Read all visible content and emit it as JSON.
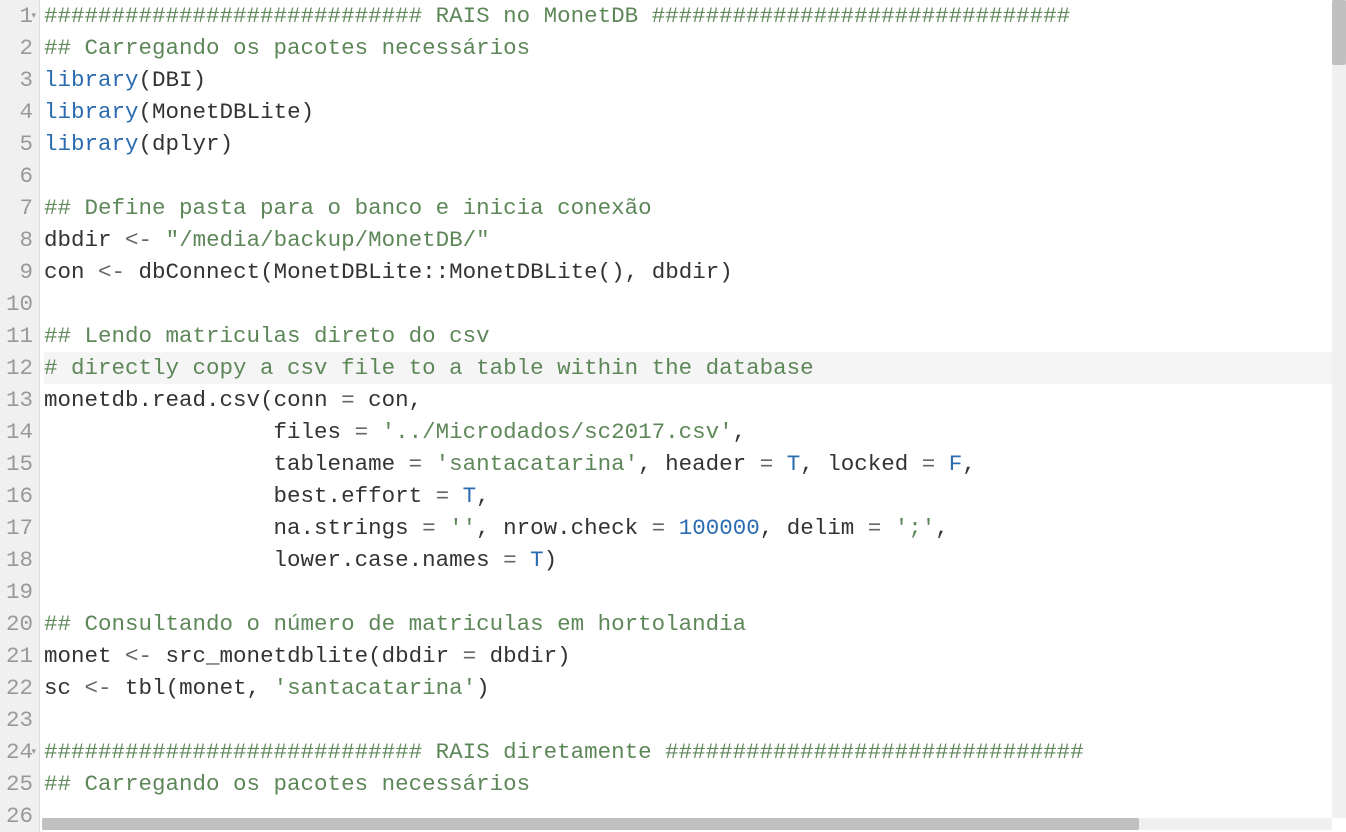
{
  "lines": [
    {
      "num": "1",
      "fold": true,
      "tokens": [
        {
          "c": "comment",
          "t": "############################ RAIS no MonetDB ###############################"
        }
      ]
    },
    {
      "num": "2",
      "tokens": [
        {
          "c": "comment",
          "t": "## Carregando os pacotes necessários"
        }
      ]
    },
    {
      "num": "3",
      "tokens": [
        {
          "c": "builtin",
          "t": "library"
        },
        {
          "c": "paren",
          "t": "("
        },
        {
          "c": "ident",
          "t": "DBI"
        },
        {
          "c": "paren",
          "t": ")"
        }
      ]
    },
    {
      "num": "4",
      "tokens": [
        {
          "c": "builtin",
          "t": "library"
        },
        {
          "c": "paren",
          "t": "("
        },
        {
          "c": "ident",
          "t": "MonetDBLite"
        },
        {
          "c": "paren",
          "t": ")"
        }
      ]
    },
    {
      "num": "5",
      "tokens": [
        {
          "c": "builtin",
          "t": "library"
        },
        {
          "c": "paren",
          "t": "("
        },
        {
          "c": "ident",
          "t": "dplyr"
        },
        {
          "c": "paren",
          "t": ")"
        }
      ]
    },
    {
      "num": "6",
      "tokens": []
    },
    {
      "num": "7",
      "tokens": [
        {
          "c": "comment",
          "t": "## Define pasta para o banco e inicia conexão"
        }
      ]
    },
    {
      "num": "8",
      "tokens": [
        {
          "c": "ident",
          "t": "dbdir "
        },
        {
          "c": "operator",
          "t": "<-"
        },
        {
          "c": "ident",
          "t": " "
        },
        {
          "c": "string",
          "t": "\"/media/backup/MonetDB/\""
        }
      ]
    },
    {
      "num": "9",
      "tokens": [
        {
          "c": "ident",
          "t": "con "
        },
        {
          "c": "operator",
          "t": "<-"
        },
        {
          "c": "ident",
          "t": " dbConnect"
        },
        {
          "c": "paren",
          "t": "("
        },
        {
          "c": "ident",
          "t": "MonetDBLite"
        },
        {
          "c": "scope",
          "t": "::"
        },
        {
          "c": "ident",
          "t": "MonetDBLite"
        },
        {
          "c": "paren",
          "t": "()"
        },
        {
          "c": "ident",
          "t": ", dbdir"
        },
        {
          "c": "paren",
          "t": ")"
        }
      ]
    },
    {
      "num": "10",
      "tokens": []
    },
    {
      "num": "11",
      "tokens": [
        {
          "c": "comment",
          "t": "## Lendo matriculas direto do csv"
        }
      ]
    },
    {
      "num": "12",
      "highlight": true,
      "tokens": [
        {
          "c": "comment",
          "t": "# directly copy a csv file to a table within the database"
        }
      ]
    },
    {
      "num": "13",
      "tokens": [
        {
          "c": "ident",
          "t": "monetdb.read.csv"
        },
        {
          "c": "paren",
          "t": "("
        },
        {
          "c": "ident",
          "t": "conn "
        },
        {
          "c": "operator",
          "t": "="
        },
        {
          "c": "ident",
          "t": " con,"
        }
      ]
    },
    {
      "num": "14",
      "tokens": [
        {
          "c": "ident",
          "t": "                 files "
        },
        {
          "c": "operator",
          "t": "="
        },
        {
          "c": "ident",
          "t": " "
        },
        {
          "c": "string",
          "t": "'../Microdados/sc2017.csv'"
        },
        {
          "c": "ident",
          "t": ","
        }
      ]
    },
    {
      "num": "15",
      "tokens": [
        {
          "c": "ident",
          "t": "                 tablename "
        },
        {
          "c": "operator",
          "t": "="
        },
        {
          "c": "ident",
          "t": " "
        },
        {
          "c": "string",
          "t": "'santacatarina'"
        },
        {
          "c": "ident",
          "t": ", header "
        },
        {
          "c": "operator",
          "t": "="
        },
        {
          "c": "ident",
          "t": " "
        },
        {
          "c": "bool",
          "t": "T"
        },
        {
          "c": "ident",
          "t": ", locked "
        },
        {
          "c": "operator",
          "t": "="
        },
        {
          "c": "ident",
          "t": " "
        },
        {
          "c": "bool",
          "t": "F"
        },
        {
          "c": "ident",
          "t": ","
        }
      ]
    },
    {
      "num": "16",
      "tokens": [
        {
          "c": "ident",
          "t": "                 best.effort "
        },
        {
          "c": "operator",
          "t": "="
        },
        {
          "c": "ident",
          "t": " "
        },
        {
          "c": "bool",
          "t": "T"
        },
        {
          "c": "ident",
          "t": ","
        }
      ]
    },
    {
      "num": "17",
      "tokens": [
        {
          "c": "ident",
          "t": "                 na.strings "
        },
        {
          "c": "operator",
          "t": "="
        },
        {
          "c": "ident",
          "t": " "
        },
        {
          "c": "string",
          "t": "''"
        },
        {
          "c": "ident",
          "t": ", nrow.check "
        },
        {
          "c": "operator",
          "t": "="
        },
        {
          "c": "ident",
          "t": " "
        },
        {
          "c": "number",
          "t": "100000"
        },
        {
          "c": "ident",
          "t": ", delim "
        },
        {
          "c": "operator",
          "t": "="
        },
        {
          "c": "ident",
          "t": " "
        },
        {
          "c": "string",
          "t": "';'"
        },
        {
          "c": "ident",
          "t": ","
        }
      ]
    },
    {
      "num": "18",
      "tokens": [
        {
          "c": "ident",
          "t": "                 lower.case.names "
        },
        {
          "c": "operator",
          "t": "="
        },
        {
          "c": "ident",
          "t": " "
        },
        {
          "c": "bool",
          "t": "T"
        },
        {
          "c": "paren",
          "t": ")"
        }
      ]
    },
    {
      "num": "19",
      "tokens": []
    },
    {
      "num": "20",
      "tokens": [
        {
          "c": "comment",
          "t": "## Consultando o número de matriculas em hortolandia"
        }
      ]
    },
    {
      "num": "21",
      "tokens": [
        {
          "c": "ident",
          "t": "monet "
        },
        {
          "c": "operator",
          "t": "<-"
        },
        {
          "c": "ident",
          "t": " src_monetdblite"
        },
        {
          "c": "paren",
          "t": "("
        },
        {
          "c": "ident",
          "t": "dbdir "
        },
        {
          "c": "operator",
          "t": "="
        },
        {
          "c": "ident",
          "t": " dbdir"
        },
        {
          "c": "paren",
          "t": ")"
        }
      ]
    },
    {
      "num": "22",
      "tokens": [
        {
          "c": "ident",
          "t": "sc "
        },
        {
          "c": "operator",
          "t": "<-"
        },
        {
          "c": "ident",
          "t": " tbl"
        },
        {
          "c": "paren",
          "t": "("
        },
        {
          "c": "ident",
          "t": "monet, "
        },
        {
          "c": "string",
          "t": "'santacatarina'"
        },
        {
          "c": "paren",
          "t": ")"
        }
      ]
    },
    {
      "num": "23",
      "tokens": []
    },
    {
      "num": "24",
      "fold": true,
      "tokens": [
        {
          "c": "comment",
          "t": "############################ RAIS diretamente ###############################"
        }
      ]
    },
    {
      "num": "25",
      "tokens": [
        {
          "c": "comment",
          "t": "## Carregando os pacotes necessários"
        }
      ]
    },
    {
      "num": "26",
      "tokens": []
    }
  ]
}
